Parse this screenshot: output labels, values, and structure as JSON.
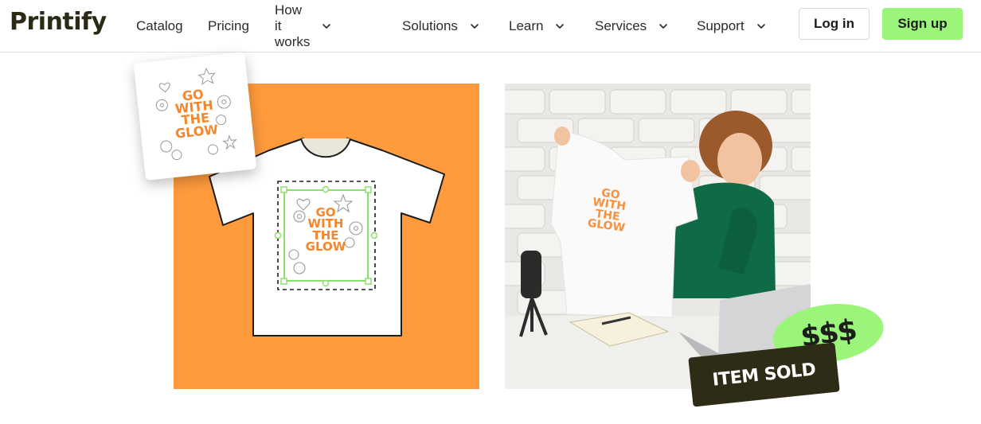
{
  "brand": {
    "logo_text": "Printify"
  },
  "nav": {
    "items": [
      {
        "label": "Catalog",
        "has_dropdown": false
      },
      {
        "label": "Pricing",
        "has_dropdown": false
      },
      {
        "label": "How it works",
        "has_dropdown": true
      },
      {
        "label": "Solutions",
        "has_dropdown": true
      },
      {
        "label": "Learn",
        "has_dropdown": true
      },
      {
        "label": "Services",
        "has_dropdown": true
      },
      {
        "label": "Support",
        "has_dropdown": true
      }
    ],
    "login_label": "Log in",
    "signup_label": "Sign up"
  },
  "hero": {
    "design_text": "GO WITH THE GLOW",
    "money_badge": "$$$",
    "sold_badge": "ITEM SOLD"
  },
  "colors": {
    "accent_green": "#9bf57a",
    "accent_orange": "#ff9b3d",
    "design_orange": "#f7862a",
    "dark_olive": "#2e2c16"
  },
  "icons": [
    "chevron-down-icon",
    "heart-doodle-icon",
    "star-doodle-icon",
    "flower-doodle-icon",
    "selection-handle-icon"
  ]
}
